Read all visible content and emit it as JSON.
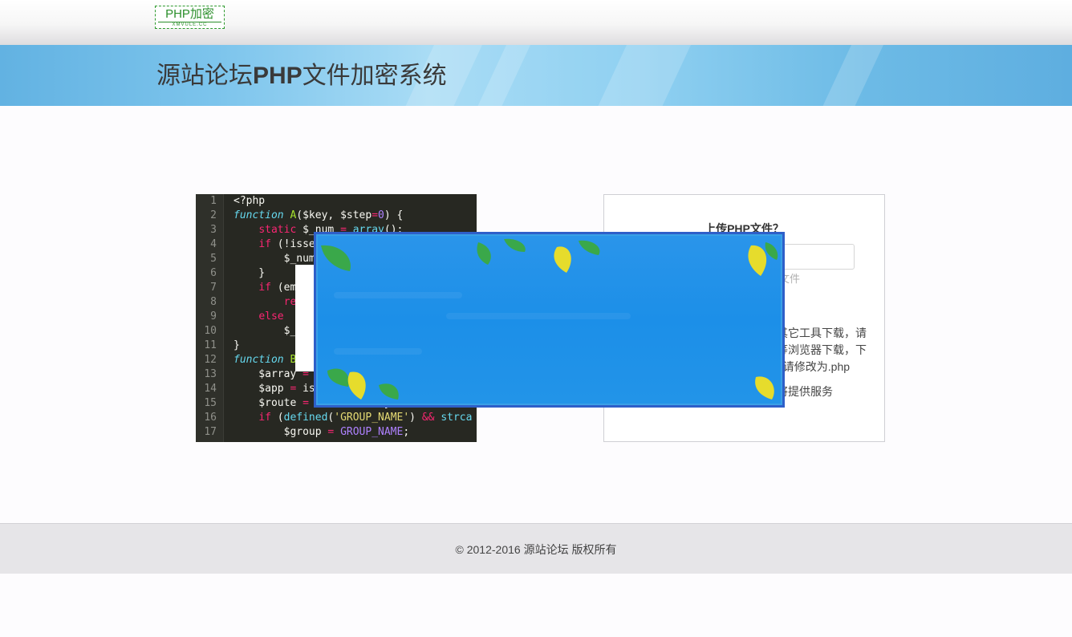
{
  "header": {
    "logo_text": "PHP加密",
    "logo_sub": "XMVULE.CC"
  },
  "banner": {
    "title_prefix": "源站论坛",
    "title_bold": "PHP",
    "title_suffix": "文件加密系统"
  },
  "code_sample": {
    "lines": [
      {
        "n": "1"
      },
      {
        "n": "2"
      },
      {
        "n": "3"
      },
      {
        "n": "4"
      },
      {
        "n": "5"
      },
      {
        "n": "6"
      },
      {
        "n": "7"
      },
      {
        "n": "8"
      },
      {
        "n": "9"
      },
      {
        "n": "10"
      },
      {
        "n": "11"
      },
      {
        "n": "12"
      },
      {
        "n": "13"
      },
      {
        "n": "14"
      },
      {
        "n": "15"
      },
      {
        "n": "16"
      },
      {
        "n": "17"
      }
    ]
  },
  "upload": {
    "title": "上传PHP文件？",
    "hint": "文件",
    "para1_l1": "其它工具下载，请",
    "para1_l2": "等浏览器下载，下",
    "para1_l3": "p请修改为.php",
    "para2": "将提供服务"
  },
  "footer": {
    "copyright": "© 2012-2016 源站论坛 版权所有"
  },
  "colors": {
    "banner": "#62b2e2",
    "popup": "#1c8fe8",
    "code_bg": "#272822",
    "footer_bg": "#e6e5e8"
  }
}
